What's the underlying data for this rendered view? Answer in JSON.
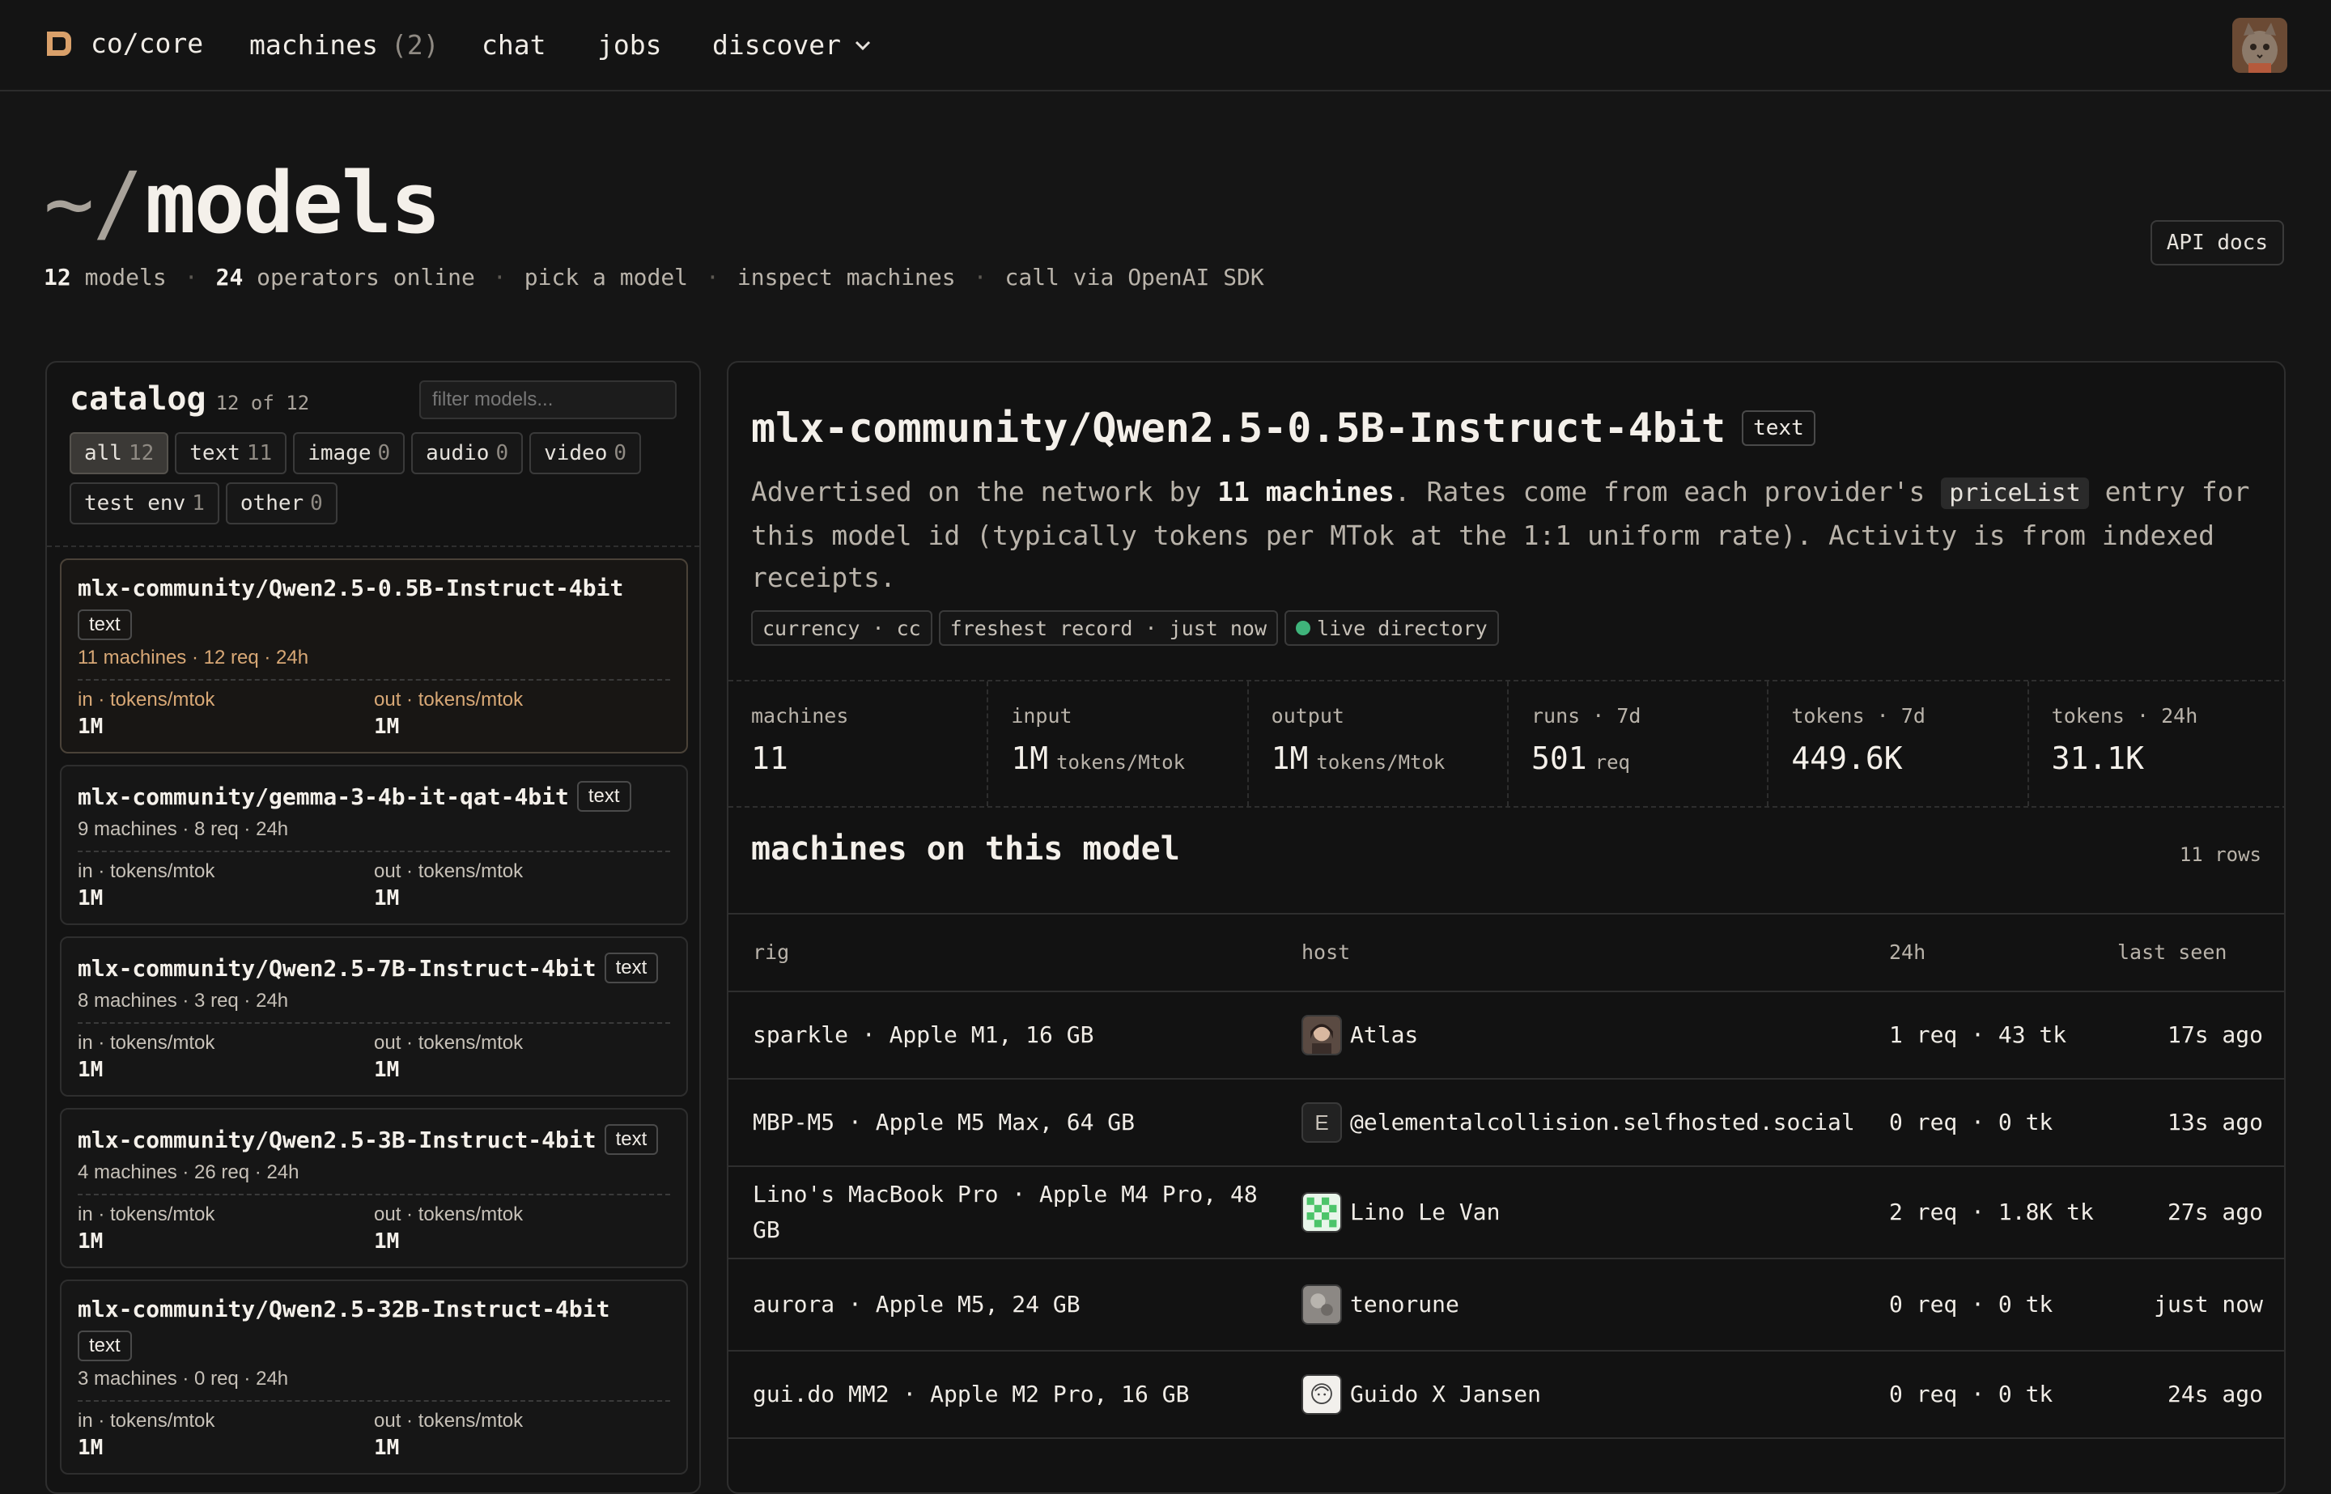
{
  "nav": {
    "brand": "co/core",
    "items": [
      {
        "label": "machines",
        "count": "(2)"
      },
      {
        "label": "chat"
      },
      {
        "label": "jobs"
      },
      {
        "label": "discover"
      }
    ]
  },
  "header": {
    "title_prefix": "~/",
    "title": "models",
    "models_count": "12",
    "models_label": "models",
    "operators_count": "24",
    "operators_label": "operators online",
    "hint1": "pick a model",
    "hint2": "inspect machines",
    "hint3": "call via OpenAI SDK",
    "api_docs": "API docs"
  },
  "catalog": {
    "title": "catalog",
    "count": "12 of 12",
    "filter_placeholder": "filter models...",
    "chips": [
      {
        "label": "all",
        "n": "12"
      },
      {
        "label": "text",
        "n": "11"
      },
      {
        "label": "image",
        "n": "0"
      },
      {
        "label": "audio",
        "n": "0"
      },
      {
        "label": "video",
        "n": "0"
      },
      {
        "label": "test env",
        "n": "1"
      },
      {
        "label": "other",
        "n": "0"
      }
    ],
    "models": [
      {
        "name": "mlx-community/Qwen2.5-0.5B-Instruct-4bit",
        "tag": "text",
        "meta": "11 machines · 12 req · 24h",
        "in_label": "in · tokens/mtok",
        "in_val": "1M",
        "out_label": "out · tokens/mtok",
        "out_val": "1M"
      },
      {
        "name": "mlx-community/gemma-3-4b-it-qat-4bit",
        "tag": "text",
        "meta": "9 machines · 8 req · 24h",
        "in_label": "in · tokens/mtok",
        "in_val": "1M",
        "out_label": "out · tokens/mtok",
        "out_val": "1M"
      },
      {
        "name": "mlx-community/Qwen2.5-7B-Instruct-4bit",
        "tag": "text",
        "meta": "8 machines · 3 req · 24h",
        "in_label": "in · tokens/mtok",
        "in_val": "1M",
        "out_label": "out · tokens/mtok",
        "out_val": "1M"
      },
      {
        "name": "mlx-community/Qwen2.5-3B-Instruct-4bit",
        "tag": "text",
        "meta": "4 machines · 26 req · 24h",
        "in_label": "in · tokens/mtok",
        "in_val": "1M",
        "out_label": "out · tokens/mtok",
        "out_val": "1M"
      },
      {
        "name": "mlx-community/Qwen2.5-32B-Instruct-4bit",
        "tag": "text",
        "meta": "3 machines · 0 req · 24h",
        "in_label": "in · tokens/mtok",
        "in_val": "1M",
        "out_label": "out · tokens/mtok",
        "out_val": "1M"
      }
    ]
  },
  "detail": {
    "name": "mlx-community/Qwen2.5-0.5B-Instruct-4bit",
    "tag": "text",
    "desc_a": "Advertised on the network by ",
    "desc_b": "11 machines",
    "desc_c": ". Rates come from each provider's ",
    "desc_code": "priceList",
    "desc_d": " entry for this model id (typically tokens per MTok at the 1:1 uniform rate). Activity is from indexed receipts.",
    "pills": [
      "currency · cc",
      "freshest record · just now",
      "live directory"
    ],
    "stats": [
      {
        "label": "machines",
        "value": "11",
        "unit": ""
      },
      {
        "label": "input",
        "value": "1M",
        "unit": "tokens/Mtok"
      },
      {
        "label": "output",
        "value": "1M",
        "unit": "tokens/Mtok"
      },
      {
        "label": "runs · 7d",
        "value": "501",
        "unit": "req"
      },
      {
        "label": "tokens · 7d",
        "value": "449.6K",
        "unit": ""
      },
      {
        "label": "tokens · 24h",
        "value": "31.1K",
        "unit": ""
      }
    ],
    "machines_title": "machines on this model",
    "rows_count": "11 rows",
    "columns": [
      "rig",
      "host",
      "24h",
      "last seen"
    ],
    "rows": [
      {
        "rig": "sparkle · Apple M1, 16 GB",
        "host": "Atlas",
        "avatar": "photo",
        "h24": "1 req · 43 tk",
        "last": "17s ago"
      },
      {
        "rig": "MBP-M5 · Apple M5 Max, 64 GB",
        "host": "@elementalcollision.selfhosted.social",
        "avatar_letter": "E",
        "h24": "0 req · 0 tk",
        "last": "13s ago"
      },
      {
        "rig": "Lino's MacBook Pro · Apple M4 Pro, 48 GB",
        "host": "Lino Le Van",
        "avatar": "checker",
        "h24": "2 req · 1.8K tk",
        "last": "27s ago"
      },
      {
        "rig": "aurora · Apple M5, 24 GB",
        "host": "tenorune",
        "avatar": "grey",
        "h24": "0 req · 0 tk",
        "last": "just now"
      },
      {
        "rig": "gui.do MM2 · Apple M2 Pro, 16 GB",
        "host": "Guido X Jansen",
        "avatar": "sketch",
        "h24": "0 req · 0 tk",
        "last": "24s ago"
      }
    ]
  }
}
